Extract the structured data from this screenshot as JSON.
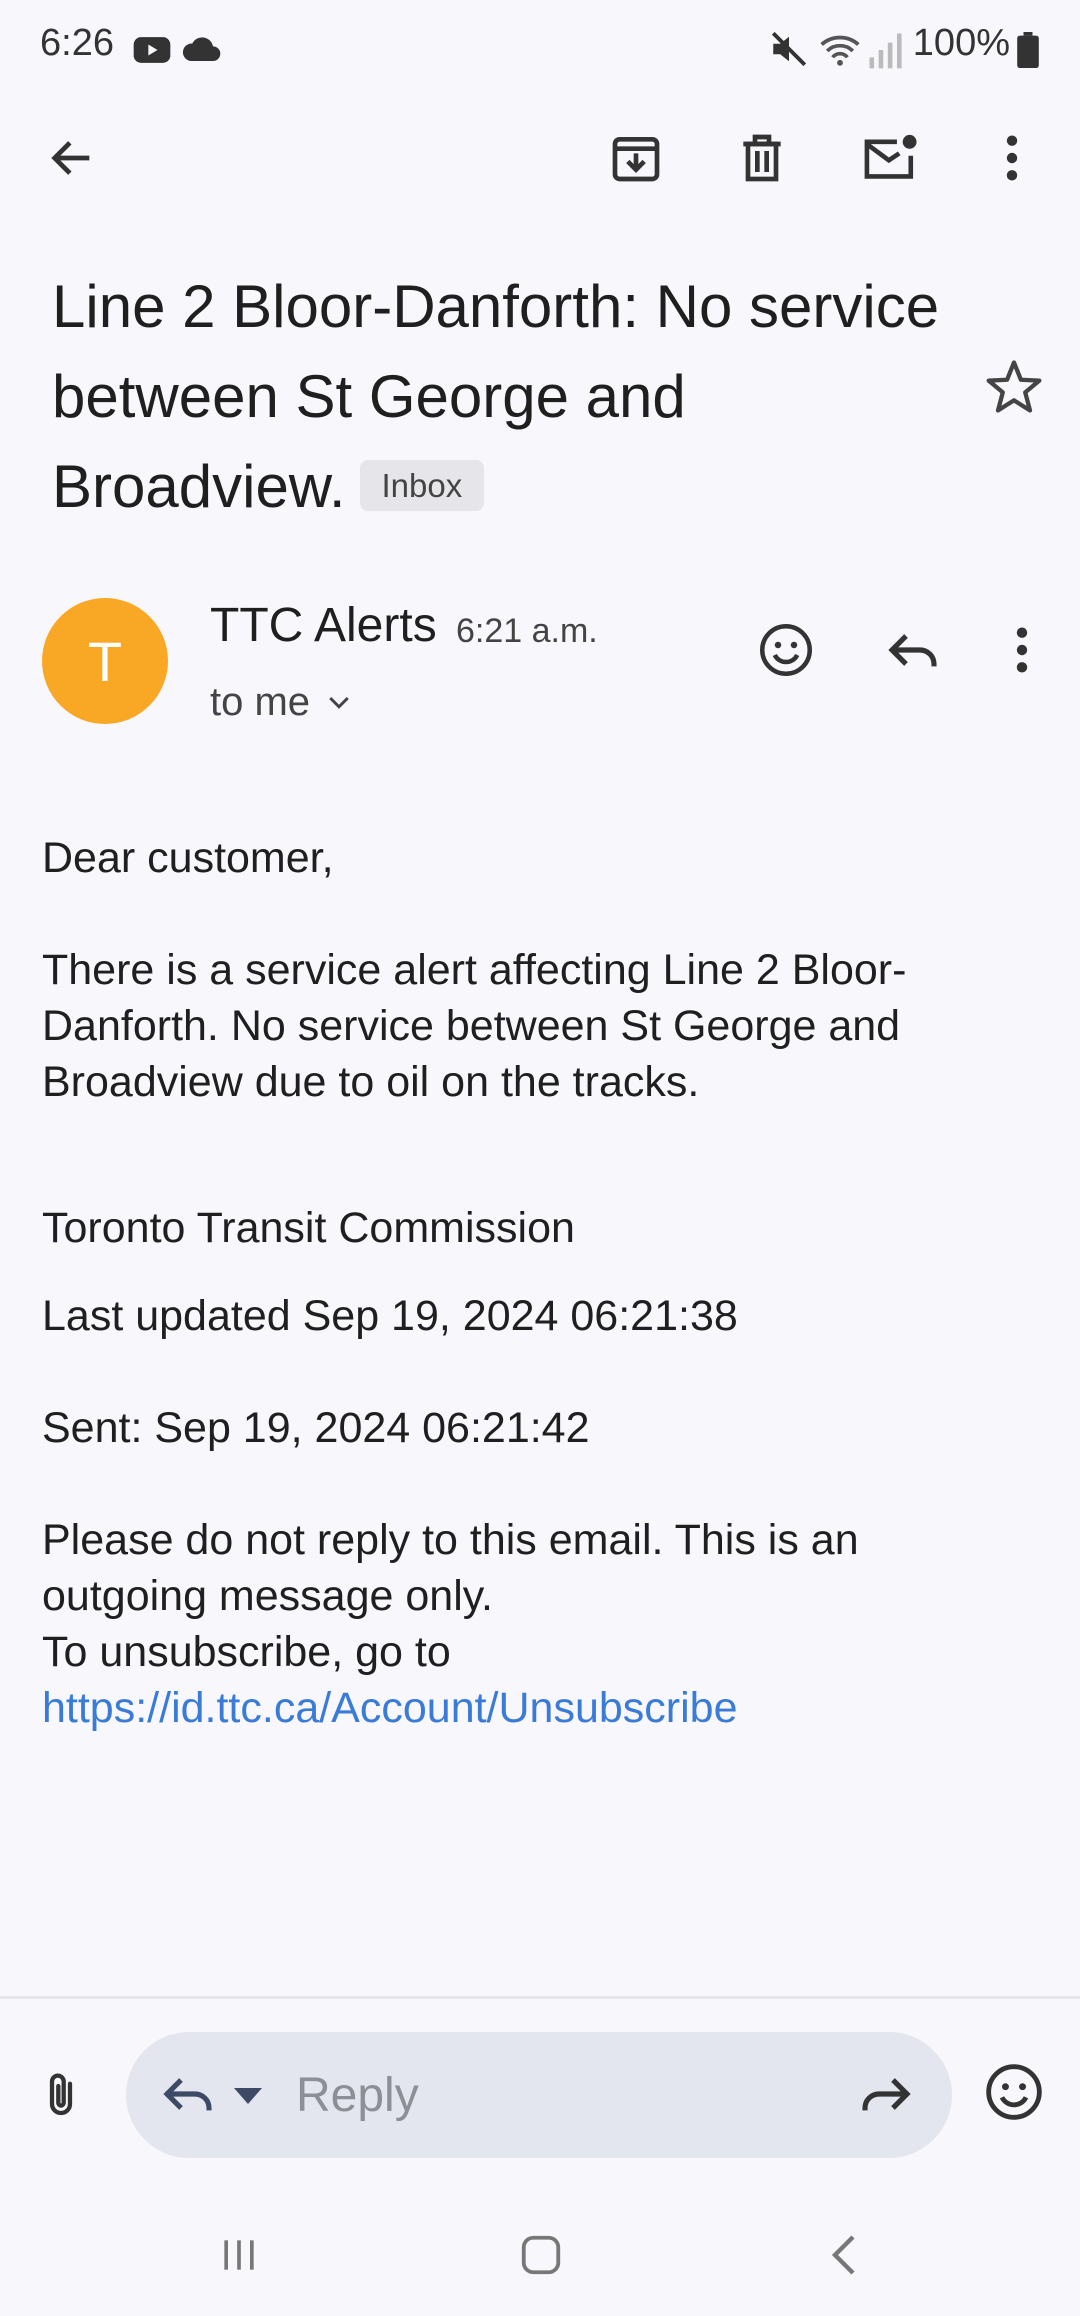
{
  "status_bar": {
    "time": "6:26",
    "battery": "100%",
    "icons": [
      "youtube-icon",
      "cloud-icon",
      "mute-icon",
      "wifi-icon",
      "signal-icon",
      "battery-icon"
    ]
  },
  "toolbar": {
    "icons": [
      "back-arrow-icon",
      "archive-icon",
      "delete-icon",
      "mark-unread-icon",
      "more-vert-icon"
    ]
  },
  "email": {
    "subject": "Line 2 Bloor-Danforth: No service between St George and Broadview.",
    "label": "Inbox",
    "sender": {
      "initial": "T",
      "name": "TTC Alerts",
      "time": "6:21 a.m.",
      "recipient": "to me",
      "avatar_color": "#f9a825"
    },
    "body": {
      "greeting": "Dear customer,",
      "alert": "There is a service alert affecting Line 2 Bloor-Danforth. No service between St George and Broadview due to oil on the tracks.",
      "organization": "Toronto Transit Commission",
      "last_updated": "Last updated Sep 19, 2024 06:21:38",
      "sent": "Sent: Sep 19, 2024 06:21:42",
      "notice_line1": "Please do not reply to this email. This is an outgoing message only.",
      "notice_line2": "To unsubscribe, go to",
      "unsubscribe_link": "https://id.ttc.ca/Account/Unsubscribe"
    }
  },
  "composer": {
    "placeholder": "Reply"
  },
  "colors": {
    "background": "#f7f7fc",
    "link": "#3b7bd8",
    "accent_avatar": "#f9a825",
    "reply_bar": "#e4e6ef"
  }
}
